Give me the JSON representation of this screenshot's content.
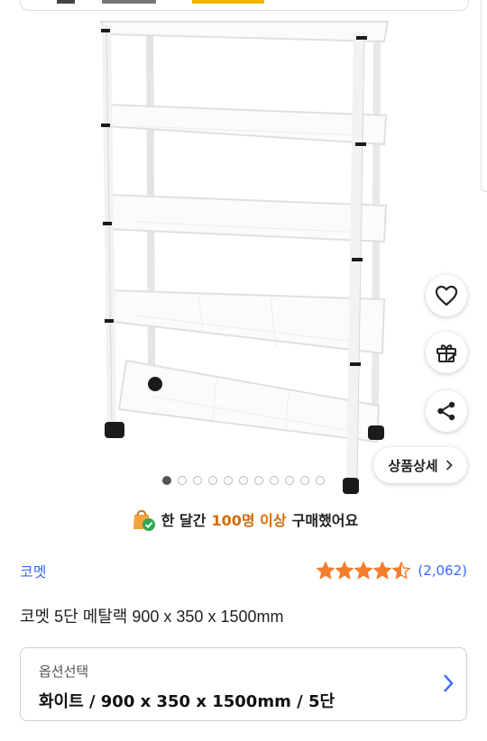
{
  "top_strip": {
    "partial_text": ""
  },
  "actions": {
    "wishlist_icon": "heart-icon",
    "gift_icon": "gift-icon",
    "share_icon": "share-icon",
    "detail_label": "상품상세"
  },
  "gallery": {
    "total_images": 11,
    "current_index": 1
  },
  "purchase_info": {
    "prefix": "한 달간",
    "highlight": "100명 이상",
    "suffix": "구매했어요"
  },
  "product": {
    "seller": "코멧",
    "rating": 4.5,
    "review_count": "(2,062)",
    "title": "코멧 5단 메탈랙 900 x 350 x 1500mm"
  },
  "option": {
    "label": "옵션선택",
    "value": "화이트 / 900 x 350 x 1500mm / 5단"
  },
  "colors": {
    "link_blue": "#346aff",
    "star_orange": "#f57c2b",
    "accent_orange": "#d46b08",
    "bag_orange": "#f4a23a",
    "check_green": "#2fa84f"
  }
}
